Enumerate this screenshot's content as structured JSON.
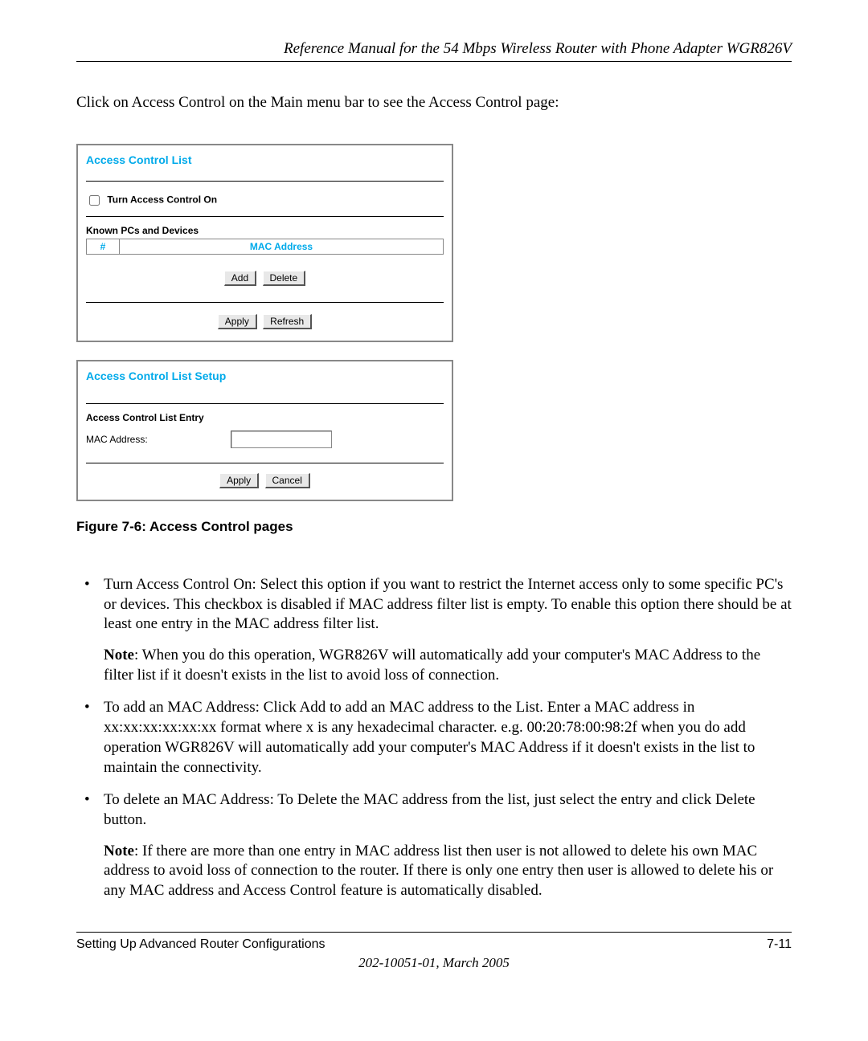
{
  "header": {
    "title": "Reference Manual for the 54 Mbps Wireless Router with Phone Adapter WGR826V"
  },
  "intro": "Click on Access Control on the Main menu bar to see the Access Control page:",
  "panel_acl": {
    "title": "Access Control List",
    "checkbox_label": "Turn Access Control On",
    "known_label": "Known PCs and Devices",
    "col_num": "#",
    "col_mac": "MAC Address",
    "btn_add": "Add",
    "btn_delete": "Delete",
    "btn_apply": "Apply",
    "btn_refresh": "Refresh"
  },
  "panel_setup": {
    "title": "Access Control List Setup",
    "entry_label": "Access Control List Entry",
    "mac_label": "MAC Address:",
    "mac_value": "",
    "btn_apply": "Apply",
    "btn_cancel": "Cancel"
  },
  "caption": "Figure 7-6:  Access Control pages",
  "bullets": {
    "b1": "Turn Access Control On: Select this option if you want to restrict the Internet access only to some specific PC's or devices. This checkbox is disabled if MAC address filter list is empty. To enable this option there should be at least one entry in the MAC address filter list.",
    "b1_note_label": "Note",
    "b1_note": ": When you do this operation, WGR826V will automatically add your computer's MAC Address to the filter list if it doesn't exists in the list to avoid loss of connection.",
    "b2": "To add an MAC Address: Click Add to add an MAC address to the List. Enter a MAC address in xx:xx:xx:xx:xx:xx format where x is any hexadecimal character. e.g. 00:20:78:00:98:2f when you do add operation WGR826V will automatically add your computer's MAC Address if it doesn't exists in the list to maintain the connectivity.",
    "b3": "To delete an MAC Address: To Delete the MAC address from the list, just select the entry and click Delete button.",
    "b3_note_label": "Note",
    "b3_note": ": If there are more than one entry in MAC address list then user is not allowed to delete his own MAC address to avoid loss of connection to the router. If there is only one entry then user is allowed to delete his or any MAC address and Access Control feature is automatically disabled."
  },
  "footer": {
    "section": "Setting Up Advanced Router Configurations",
    "page": "7-11",
    "docid": "202-10051-01, March 2005"
  }
}
